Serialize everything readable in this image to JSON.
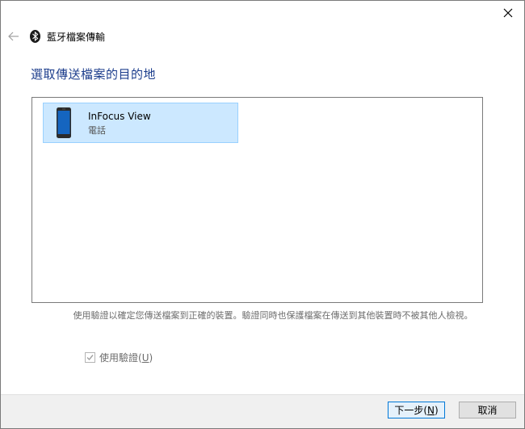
{
  "window": {
    "title": "藍牙檔案傳輸"
  },
  "heading": "選取傳送檔案的目的地",
  "devices": [
    {
      "name": "InFocus View",
      "type": "電話",
      "icon": "phone-icon",
      "selected": true
    }
  ],
  "info_text": "使用驗證以確定您傳送檔案到正確的裝置。驗證同時也保護檔案在傳送到其他裝置時不被其他人檢視。",
  "auth_checkbox": {
    "label": "使用驗證",
    "accel": "U",
    "checked": true,
    "enabled": false
  },
  "buttons": {
    "next_label": "下一步",
    "next_accel": "N",
    "cancel_label": "取消"
  },
  "colors": {
    "heading": "#1c3d8c",
    "selection_bg": "#cce8ff",
    "selection_border": "#99d1ff",
    "accent": "#0078d7"
  }
}
